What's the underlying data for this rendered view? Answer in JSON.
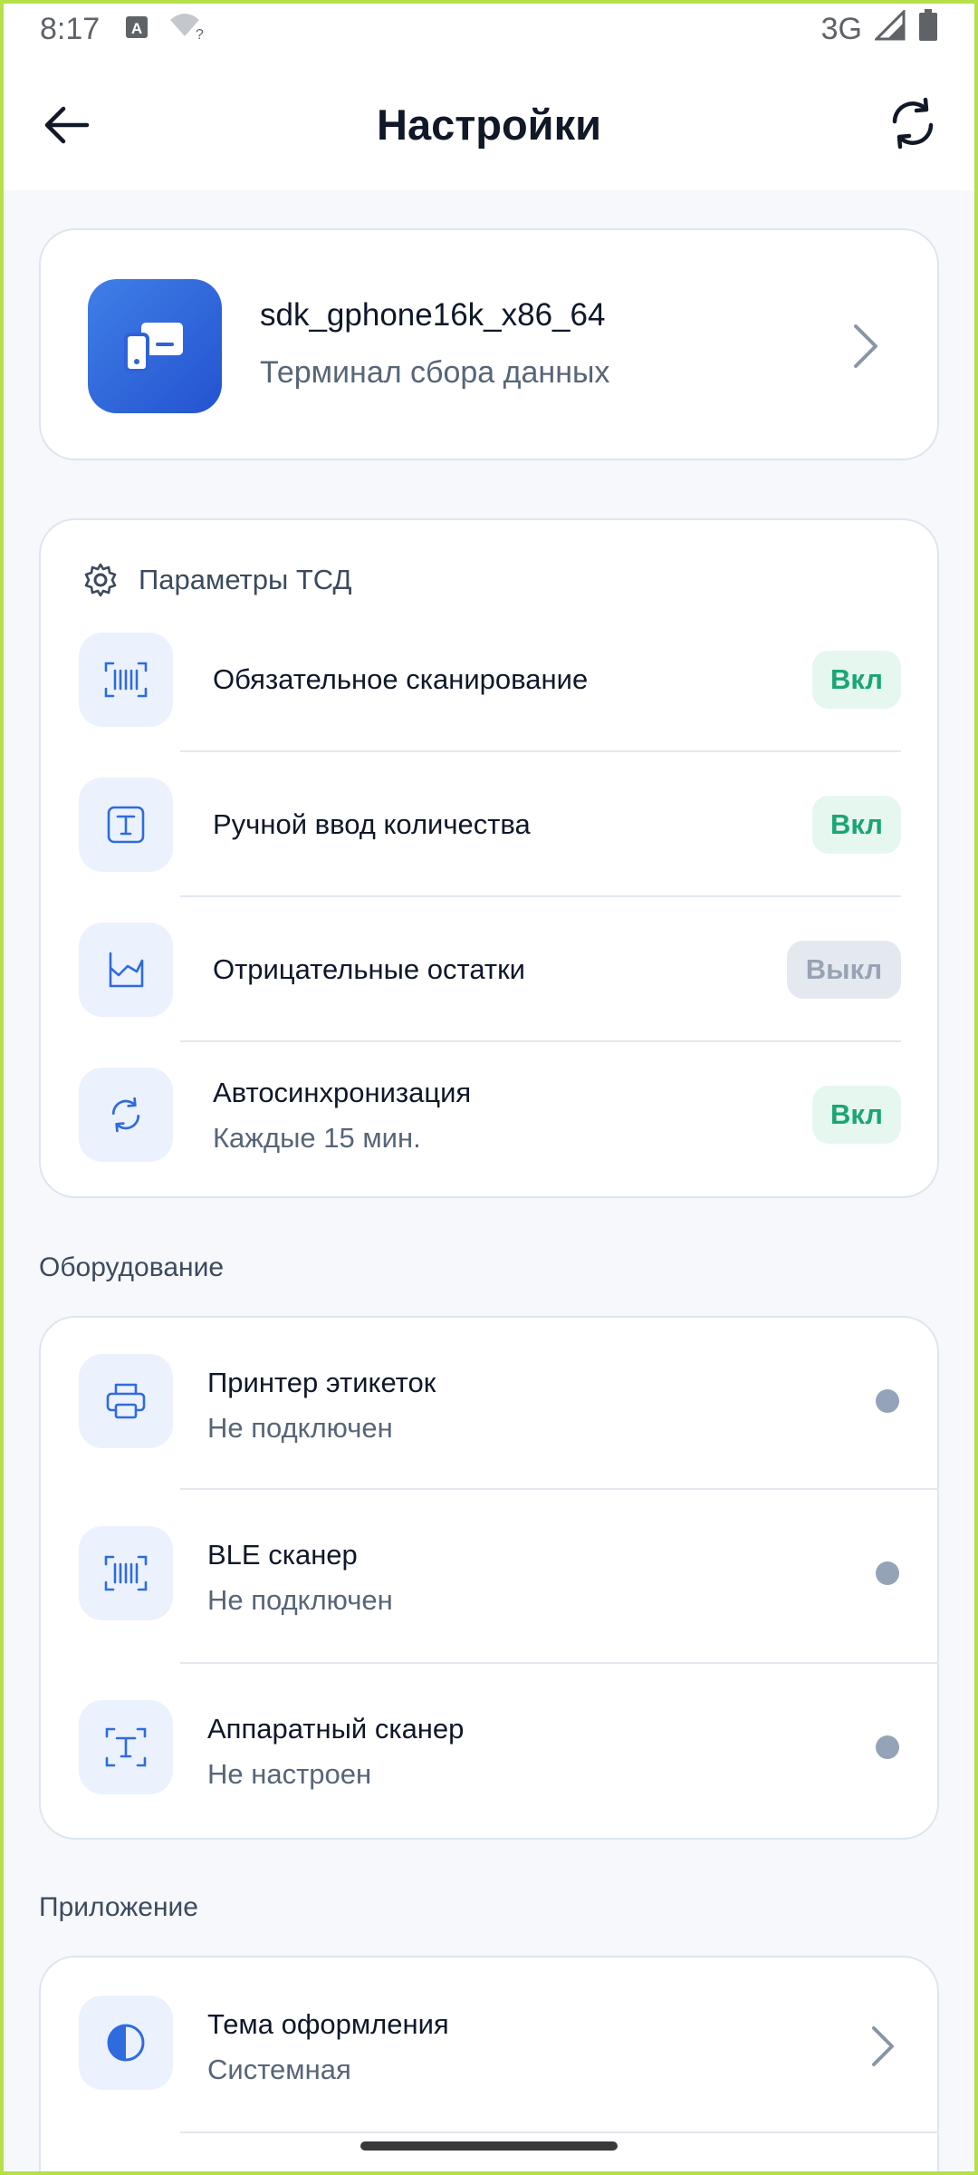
{
  "status_bar": {
    "time": "8:17",
    "network": "3G",
    "icons": [
      "keyboard-a-icon",
      "wifi-unknown-icon",
      "signal-icon",
      "battery-icon"
    ]
  },
  "app_bar": {
    "title": "Настройки",
    "back_icon": "arrow-left-icon",
    "action_icon": "sync-icon"
  },
  "device": {
    "name": "sdk_gphone16k_x86_64",
    "subtitle": "Терминал сбора данных",
    "icon": "devices-icon"
  },
  "params": {
    "header": "Параметры ТСД",
    "header_icon": "gear-icon",
    "items": [
      {
        "title": "Обязательное сканирование",
        "state": "Вкл",
        "icon": "barcode-scan-icon"
      },
      {
        "title": "Ручной ввод количества",
        "state": "Вкл",
        "icon": "text-input-icon"
      },
      {
        "title": "Отрицательные остатки",
        "state": "Выкл",
        "icon": "chart-area-icon"
      },
      {
        "title": "Автосинхронизация",
        "subtitle": "Каждые 15 мин.",
        "state": "Вкл",
        "icon": "sync-icon"
      }
    ]
  },
  "equipment": {
    "section_label": "Оборудование",
    "items": [
      {
        "title": "Принтер этикеток",
        "subtitle": "Не подключен",
        "icon": "printer-icon"
      },
      {
        "title": "BLE сканер",
        "subtitle": "Не подключен",
        "icon": "barcode-scan-icon"
      },
      {
        "title": "Аппаратный сканер",
        "subtitle": "Не настроен",
        "icon": "text-scan-icon"
      }
    ]
  },
  "application": {
    "section_label": "Приложение",
    "items": [
      {
        "title": "Тема оформления",
        "subtitle": "Системная",
        "icon": "contrast-icon"
      }
    ]
  },
  "colors": {
    "accent": "#2f6bdf",
    "on": "#1aa574",
    "off": "#98a3b3",
    "status_dot": "#94a3b8"
  }
}
